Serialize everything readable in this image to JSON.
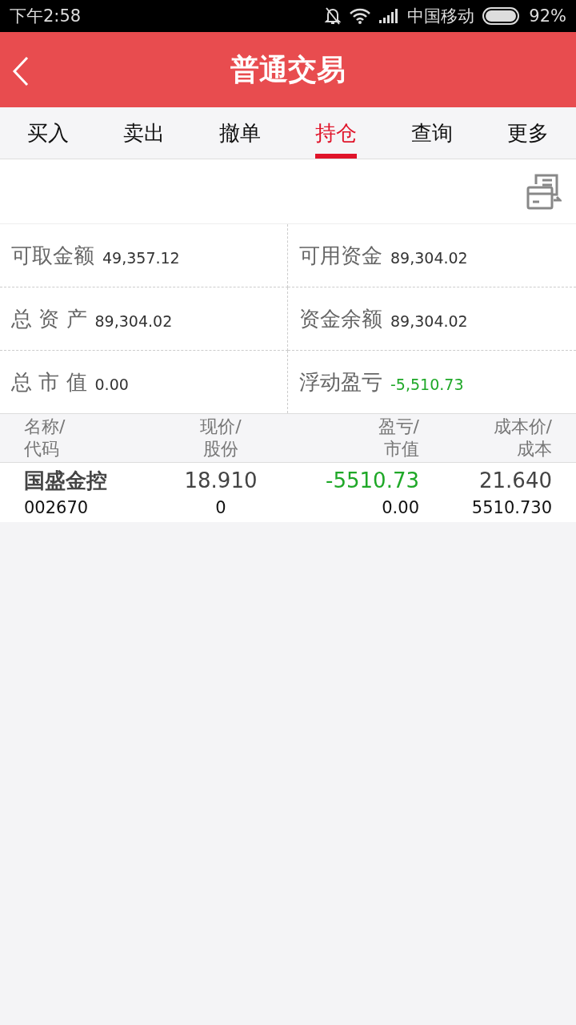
{
  "status_bar": {
    "time": "下午2:58",
    "carrier": "中国移动",
    "battery": "92%"
  },
  "header": {
    "title": "普通交易"
  },
  "tabs": [
    {
      "label": "买入",
      "selected": false
    },
    {
      "label": "卖出",
      "selected": false
    },
    {
      "label": "撤单",
      "selected": false
    },
    {
      "label": "持仓",
      "selected": true
    },
    {
      "label": "查询",
      "selected": false
    },
    {
      "label": "更多",
      "selected": false
    }
  ],
  "summary": [
    {
      "label": "可取金额",
      "value": "49,357.12",
      "color": "#333333"
    },
    {
      "label": "可用资金",
      "value": "89,304.02",
      "color": "#333333"
    },
    {
      "label": "总 资 产",
      "value": "89,304.02",
      "color": "#333333"
    },
    {
      "label": "资金余额",
      "value": "89,304.02",
      "color": "#333333"
    },
    {
      "label": "总 市 值",
      "value": "0.00",
      "color": "#333333"
    },
    {
      "label": "浮动盈亏",
      "value": "-5,510.73",
      "color": "#1fa828"
    }
  ],
  "table": {
    "columns": [
      {
        "line1": "名称/",
        "line2": "代码"
      },
      {
        "line1": "现价/",
        "line2": "股份"
      },
      {
        "line1": "盈亏/",
        "line2": "市值"
      },
      {
        "line1": "成本价/",
        "line2": "成本"
      }
    ],
    "rows": [
      {
        "name": "国盛金控",
        "code": "002670",
        "price": "18.910",
        "shares": "0",
        "pnl": {
          "value": "-5510.73",
          "color": "#1fa828"
        },
        "market_value": "0.00",
        "cost_price": "21.640",
        "cost": "5510.730"
      }
    ]
  }
}
